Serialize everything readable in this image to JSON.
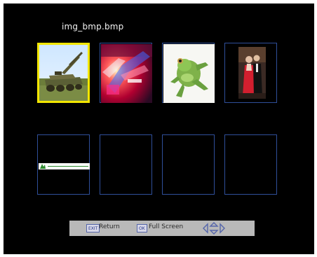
{
  "header": {
    "filename": "img_bmp.bmp"
  },
  "thumbnails": [
    {
      "icon": "tank-image-icon",
      "selected": true
    },
    {
      "icon": "abstract-colorful-image-icon",
      "selected": false
    },
    {
      "icon": "frog-image-icon",
      "selected": false
    },
    {
      "icon": "couple-portrait-image-icon",
      "selected": false
    },
    {
      "icon": "banner-text-image-icon",
      "selected": false,
      "caption": "Please consider the environment before printing this email"
    },
    {
      "icon": "empty-slot",
      "selected": false
    },
    {
      "icon": "empty-slot",
      "selected": false
    },
    {
      "icon": "empty-slot",
      "selected": false
    }
  ],
  "footer": {
    "exit_key": "EXIT",
    "return_label": "Return",
    "ok_key": "OK",
    "fullscreen_label": "Full Screen"
  },
  "colors": {
    "selection": "#f2e600",
    "cell_border": "#2f4f9a",
    "footer_bg": "#b9b9b9"
  }
}
